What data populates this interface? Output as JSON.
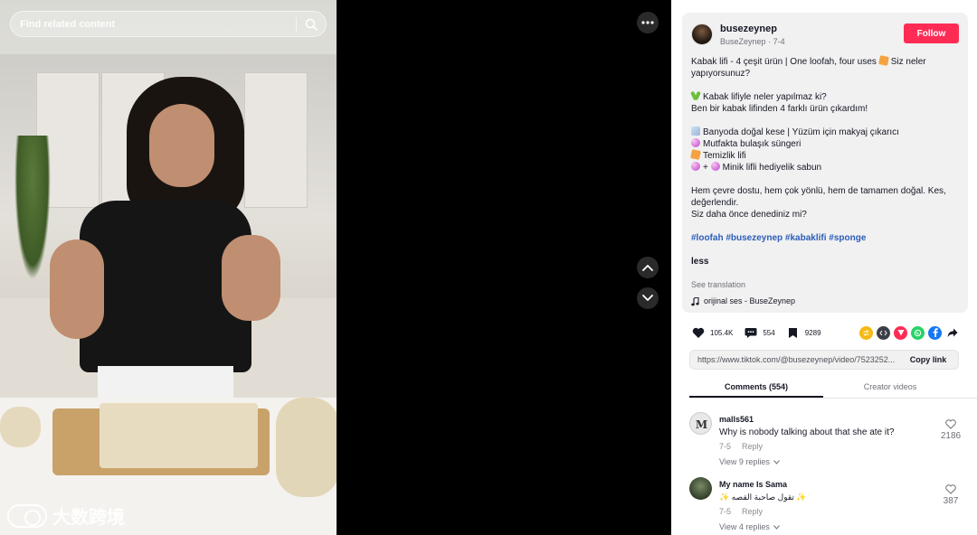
{
  "search": {
    "placeholder": "Find related content"
  },
  "watermark": {
    "text": "大数跨境"
  },
  "author": {
    "username": "busezeynep",
    "display_name": "BuseZeynep",
    "date": "7-4",
    "follow_label": "Follow"
  },
  "description": {
    "line1": "Kabak lifi - 4 çeşit ürün | One loofah, four uses",
    "line1_tail": "Siz neler yapıyorsunuz?",
    "line2": "Kabak lifiyle neler yapılmaz ki?",
    "line3": "Ben bir kabak lifinden 4 farklı ürün çıkardım!",
    "item1": "Banyoda doğal kese | Yüzüm için makyaj çıkarıcı",
    "item2": "Mutfakta bulaşık süngeri",
    "item3": "Temizlik lifi",
    "item4_mid": "+",
    "item4": "Minik lifli hediyelik sabun",
    "para2a": "Hem çevre dostu, hem çok yönlü, hem de tamamen doğal. Kes, değerlendir.",
    "para2b": "Siz daha önce denediniz mi?",
    "hashtags": "#loofah #busezeynep #kabaklifi #sponge",
    "less_label": "less",
    "see_translation": "See translation",
    "sound": "orijinal ses - BuseZeynep"
  },
  "stats": {
    "likes": "105.4K",
    "comments": "554",
    "saves": "9289"
  },
  "share_icons": [
    "repost-icon",
    "embed-icon",
    "send-icon",
    "whatsapp-icon",
    "facebook-icon",
    "share-arrow-icon"
  ],
  "link": {
    "url": "https://www.tiktok.com/@busezeynep/video/7523252...",
    "copy_label": "Copy link"
  },
  "tabs": {
    "comments": "Comments (554)",
    "creator_videos": "Creator videos"
  },
  "comments": [
    {
      "user": "malls561",
      "text": "Why is nobody talking about that she ate it?",
      "date": "7-5",
      "reply_label": "Reply",
      "view_replies": "View 9 replies",
      "likes": "2186"
    },
    {
      "user": "My name Is Sama",
      "text": "تقول صاحبة القصه",
      "date": "7-5",
      "reply_label": "Reply",
      "view_replies": "View 4 replies",
      "likes": "387"
    }
  ],
  "colors": {
    "accent": "#fe2c55",
    "hashtag": "#2b5db9",
    "panel_bg": "#ffffff",
    "card_bg": "#f1f1f2"
  }
}
